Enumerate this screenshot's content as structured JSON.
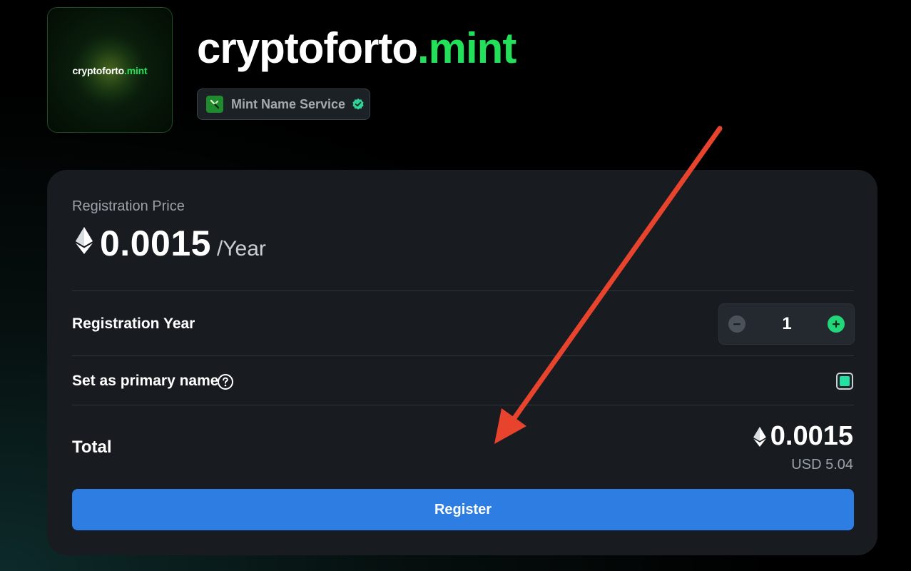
{
  "domain": {
    "name": "cryptoforto",
    "tld": ".mint"
  },
  "logo": {
    "name": "cryptoforto",
    "tld": ".mint"
  },
  "badge": {
    "label": "Mint Name Service",
    "icon": "mint-logo-icon",
    "verified_icon": "verified-check-icon"
  },
  "price": {
    "label": "Registration Price",
    "value": "0.0015",
    "unit": "/Year",
    "icon": "eth-icon"
  },
  "registration_year": {
    "label": "Registration Year",
    "value": "1",
    "minus_icon": "minus-icon",
    "plus_icon": "plus-icon"
  },
  "primary_name": {
    "label": "Set as primary name",
    "help_icon": "help-icon",
    "checked": true
  },
  "total": {
    "label": "Total",
    "eth_value": "0.0015",
    "usd_value": "USD 5.04"
  },
  "register_button": {
    "label": "Register"
  },
  "colors": {
    "accent_green": "#22e05a",
    "button_blue": "#2d7de3",
    "plus_green": "#22d67a",
    "annotation_arrow": "#e8432c"
  }
}
